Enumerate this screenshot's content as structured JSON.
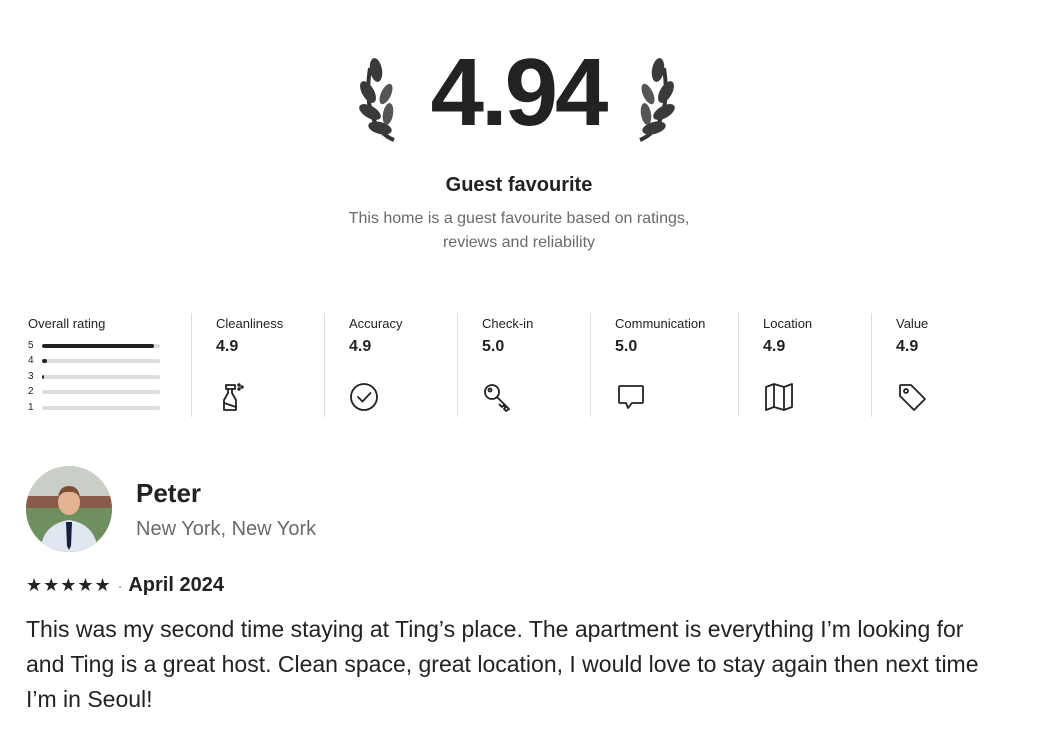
{
  "summary": {
    "score": "4.94",
    "title": "Guest favourite",
    "description": "This home is a guest favourite based on ratings, reviews and reliability"
  },
  "overall": {
    "label": "Overall rating",
    "bars": [
      {
        "stars": "5",
        "fraction": 0.95
      },
      {
        "stars": "4",
        "fraction": 0.04
      },
      {
        "stars": "3",
        "fraction": 0.015
      },
      {
        "stars": "2",
        "fraction": 0
      },
      {
        "stars": "1",
        "fraction": 0
      }
    ]
  },
  "categories": [
    {
      "label": "Cleanliness",
      "score": "4.9",
      "icon": "spray-bottle-icon"
    },
    {
      "label": "Accuracy",
      "score": "4.9",
      "icon": "check-circle-icon"
    },
    {
      "label": "Check-in",
      "score": "5.0",
      "icon": "key-icon"
    },
    {
      "label": "Communication",
      "score": "5.0",
      "icon": "chat-bubble-icon"
    },
    {
      "label": "Location",
      "score": "4.9",
      "icon": "map-icon"
    },
    {
      "label": "Value",
      "score": "4.9",
      "icon": "tag-icon"
    }
  ],
  "review": {
    "name": "Peter",
    "location": "New York, New York",
    "stars": "★★★★★",
    "separator": "·",
    "date": "April 2024",
    "text": "This was my second time staying at Ting’s place. The apartment is everything I’m looking for and Ting is a great host. Clean space, great location, I would love to stay again then next time I’m in Seoul!"
  },
  "colors": {
    "text": "#222222",
    "muted": "#6a6a6a",
    "divider": "#dddddd"
  }
}
